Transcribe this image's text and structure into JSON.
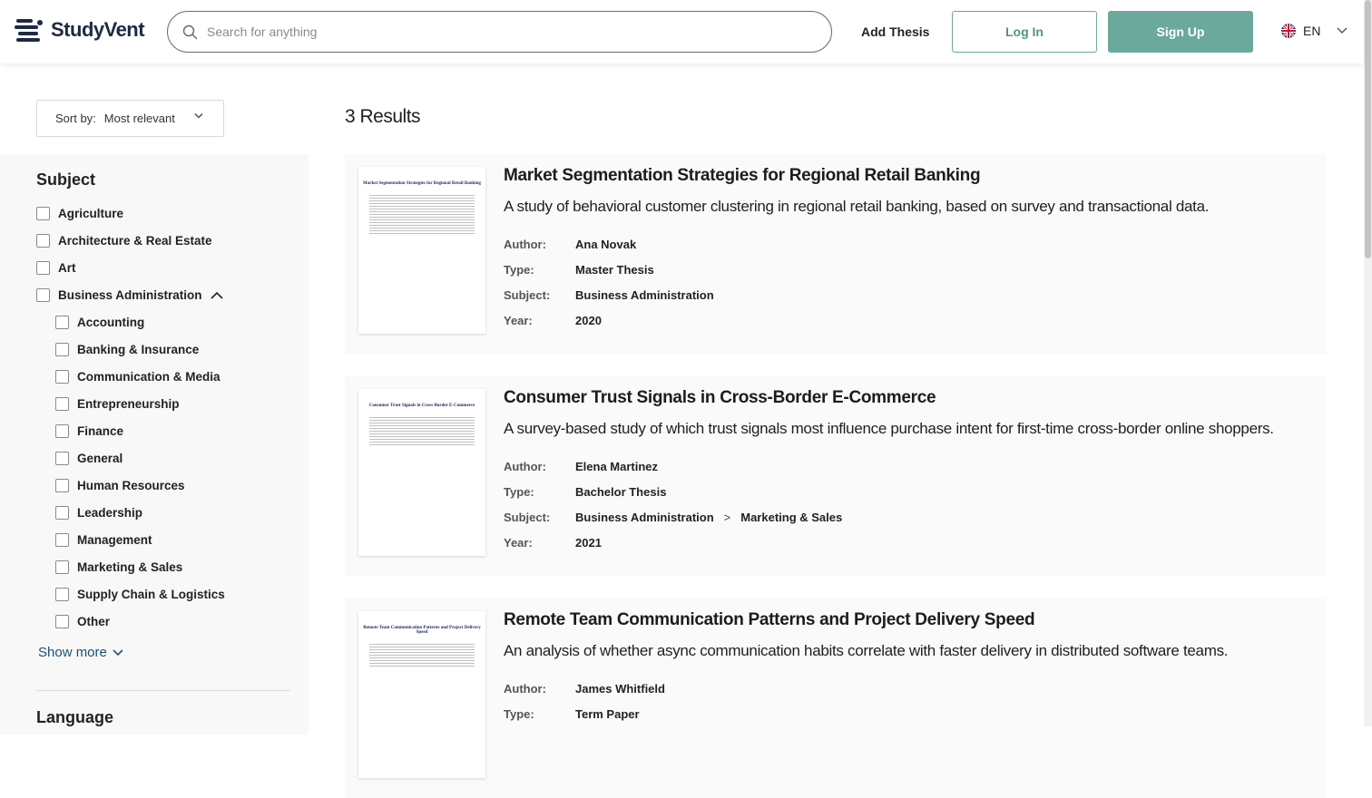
{
  "header": {
    "brand": "StudyVent",
    "search_placeholder": "Search for anything",
    "add_thesis": "Add Thesis",
    "login": "Log In",
    "signup": "Sign Up",
    "language": "EN",
    "accent_color": "#6aa99c"
  },
  "sidebar": {
    "sort_label": "Sort by:",
    "sort_value": "Most relevant",
    "subject_title": "Subject",
    "subjects": [
      "Agriculture",
      "Architecture & Real Estate",
      "Art",
      "Business Administration"
    ],
    "subcategories": [
      "Accounting",
      "Banking & Insurance",
      "Communication & Media",
      "Entrepreneurship",
      "Finance",
      "General",
      "Human Resources",
      "Leadership",
      "Management",
      "Marketing & Sales",
      "Supply Chain & Logistics",
      "Other"
    ],
    "show_more": "Show more",
    "language_title": "Language"
  },
  "results": {
    "count": "3 Results",
    "labels": {
      "author": "Author:",
      "type": "Type:",
      "subject": "Subject:",
      "year": "Year:"
    },
    "items": [
      {
        "title": "Market Segmentation Strategies for Regional Retail Banking",
        "description": "A study of behavioral customer clustering in regional retail banking, based on survey and transactional data.",
        "author": "Ana Novak",
        "type": "Master Thesis",
        "subject": "Business Administration",
        "year": "2020"
      },
      {
        "title": "Consumer Trust Signals in Cross-Border E-Commerce",
        "description": "A survey-based study of which trust signals most influence purchase intent for first-time cross-border online shoppers.",
        "author": "Elena Martinez",
        "type": "Bachelor Thesis",
        "subject": "Business Administration",
        "subject_sep": ">",
        "subject_sub": "Marketing & Sales",
        "year": "2021"
      },
      {
        "title": "Remote Team Communication Patterns and Project Delivery Speed",
        "description": "An analysis of whether async communication habits correlate with faster delivery in distributed software teams.",
        "author": "James Whitfield",
        "type": "Term Paper"
      }
    ]
  }
}
